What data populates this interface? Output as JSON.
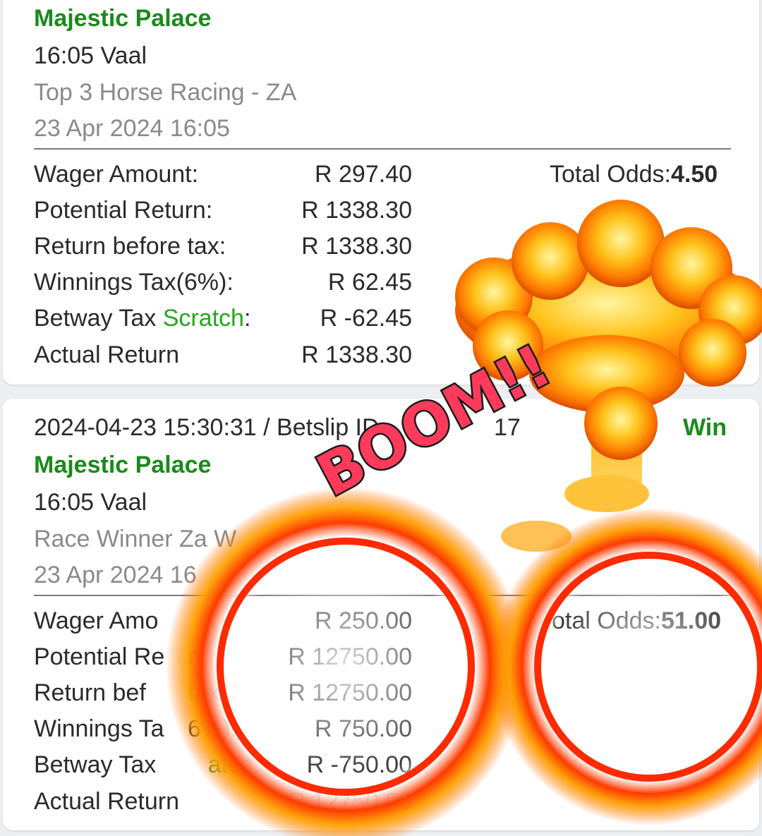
{
  "bet1": {
    "selection": "Majestic Palace",
    "race": "16:05 Vaal",
    "market": "Top 3 Horse Racing - ZA",
    "date": "23 Apr 2024 16:05",
    "total_odds_label": "Total Odds:",
    "total_odds_value": "4.50",
    "rows": [
      {
        "label": "Wager Amount:",
        "value": "R 297.40"
      },
      {
        "label": "Potential Return:",
        "value": "R 1338.30"
      },
      {
        "label": "Return before tax:",
        "value": "R 1338.30"
      },
      {
        "label": "Winnings Tax(6%):",
        "value": "R 62.45"
      },
      {
        "label_prefix": "Betway Tax ",
        "label_highlight": "Scratch",
        "label_suffix": ":",
        "value": "R -62.45"
      },
      {
        "label": "Actual Return",
        "value": "R 1338.30"
      }
    ]
  },
  "bet2": {
    "header": "2024-04-23 15:30:31 / Betslip ID",
    "header_tail": "17",
    "status": "Win",
    "selection": "Majestic Palace",
    "race": "16:05 Vaal",
    "market": "Race Winner Za W",
    "date": "23 Apr 2024 16",
    "total_odds_label": "otal Odds:",
    "total_odds_value": "51.00",
    "rows": [
      {
        "label": "Wager Amo",
        "value": "R 250.00"
      },
      {
        "label": "Potential Re",
        "label_tail": "n:",
        "value": "R 12750.00"
      },
      {
        "label": "Return bef",
        "label_tail": "tax:",
        "value": "R 12750.00"
      },
      {
        "label": "Winnings Ta",
        "label_tail": "6%):",
        "value": "R 750.00"
      },
      {
        "label_prefix": "Betway Tax ",
        "label_highlight": "atch",
        "label_suffix": ":",
        "value": "R -750.00"
      },
      {
        "label": "Actual Return",
        "value": "R 12750.00"
      }
    ]
  },
  "overlay": {
    "boom": "BOOM!!",
    "stickers": [
      "explosion-cloud",
      "fire-ring-left",
      "fire-ring-right"
    ]
  },
  "colors": {
    "title_green": "#1a8a1a",
    "scratch_green": "#26a61e",
    "boom_red": "#ff3b5c",
    "fire_orange": "#ff7a00"
  }
}
